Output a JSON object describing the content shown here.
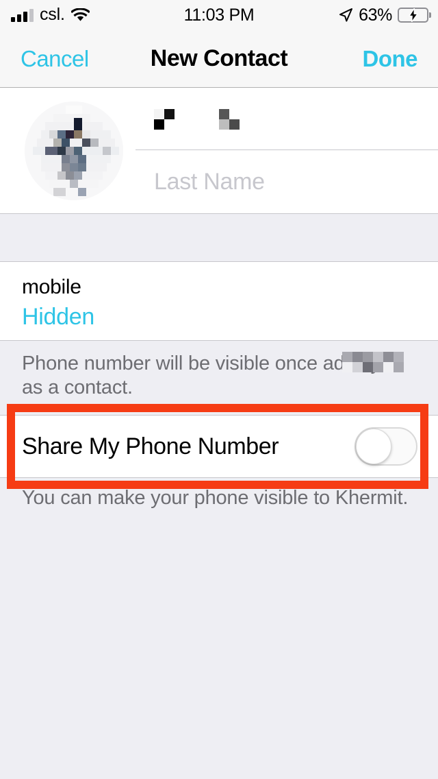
{
  "status_bar": {
    "carrier": "csl.",
    "time": "11:03 PM",
    "battery_percent": "63%",
    "battery_level": 63,
    "signal_bars_filled": 3,
    "signal_bars_total": 4,
    "wifi_icon": "wifi-icon",
    "location_icon": "location-arrow-icon",
    "battery_icon": "battery-charging-icon"
  },
  "nav_bar": {
    "cancel_label": "Cancel",
    "title": "New Contact",
    "done_label": "Done"
  },
  "name_section": {
    "avatar_icon": "contact-photo-blurred",
    "first_name_value": "",
    "first_name_redacted": true,
    "last_name_placeholder": "Last Name",
    "last_name_value": ""
  },
  "phone_section": {
    "label": "mobile",
    "value": "Hidden",
    "footnote": "Phone number will be visible once           adds you as a contact.",
    "footnote_redacted_name": true
  },
  "share_section": {
    "label": "Share My Phone Number",
    "toggle_state": "off",
    "footnote": "You can make your phone visible to Khermit."
  },
  "annotation": {
    "type": "highlight-box",
    "color": "#f63c14",
    "target": "share-my-phone-number-row"
  },
  "colors": {
    "accent": "#2ec4e6",
    "background": "#eeeef3",
    "card": "#ffffff",
    "separator": "#c8c7cc",
    "footnote_text": "#6d6d72",
    "placeholder_text": "#c7c7cd",
    "annotation_red": "#f63c14",
    "battery_green": "#4cd764"
  }
}
